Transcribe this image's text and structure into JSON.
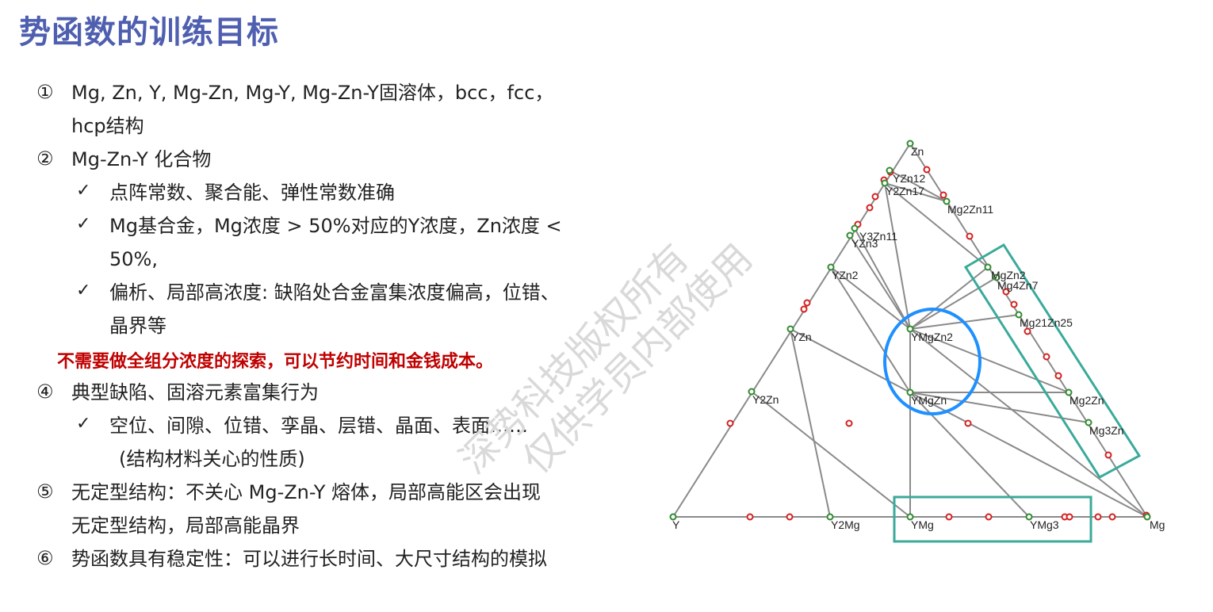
{
  "title": "势函数的训练目标",
  "items": [
    {
      "marker": "①",
      "lines": [
        "Mg, Zn, Y, Mg-Zn, Mg-Y, Mg-Zn-Y固溶体，bcc，fcc，",
        "hcp结构"
      ]
    },
    {
      "marker": "②",
      "lines": [
        "Mg-Zn-Y 化合物"
      ]
    },
    {
      "marker": "✓",
      "lines": [
        "点阵常数、聚合能、弹性常数准确"
      ]
    },
    {
      "marker": "✓",
      "lines": [
        "Mg基合金，Mg浓度 > 50%对应的Y浓度，Zn浓度 <",
        "50%,"
      ]
    },
    {
      "marker": "✓",
      "lines": [
        "偏析、局部高浓度: 缺陷处合金富集浓度偏高，位错、",
        "晶界等"
      ]
    },
    {
      "marker": "",
      "lines": [
        "不需要做全组分浓度的探索，可以节约时间和金钱成本。"
      ]
    },
    {
      "marker": "④",
      "lines": [
        "典型缺陷、固溶元素富集行为"
      ]
    },
    {
      "marker": "✓",
      "lines": [
        "空位、间隙、位错、孪晶、层错、晶面、表面……",
        "(结构材料关心的性质)"
      ]
    },
    {
      "marker": "⑤",
      "lines": [
        "无定型结构：不关心 Mg-Zn-Y 熔体，局部高能区会出现",
        "无定型结构，局部高能晶界"
      ]
    },
    {
      "marker": "⑥",
      "lines": [
        "势函数具有稳定性：可以进行长时间、大尺寸结构的模拟"
      ]
    }
  ],
  "watermark": [
    "深势科技版权所有",
    "仅供学员内部使用"
  ],
  "diagram": {
    "vertex_labels": [
      "Zn",
      "YZn12",
      "Y2Zn17",
      "Mg2Zn11",
      "Y3Zn11",
      "YZn3",
      "MgZn2",
      "Mg4Zn7",
      "YZn2",
      "Mg21Zn25",
      "YZn",
      "YMgZn2",
      "YMgZn",
      "Mg2Zn",
      "Y2Zn",
      "Mg3Zn",
      "Y",
      "Y2Mg",
      "YMg",
      "YMg3",
      "Mg"
    ],
    "colors": {
      "stable": "#2e8b2e",
      "unstable": "#d42020",
      "line": "#8a8a8a",
      "circle": "#1e90ff",
      "box": "#3aaa9a"
    }
  }
}
